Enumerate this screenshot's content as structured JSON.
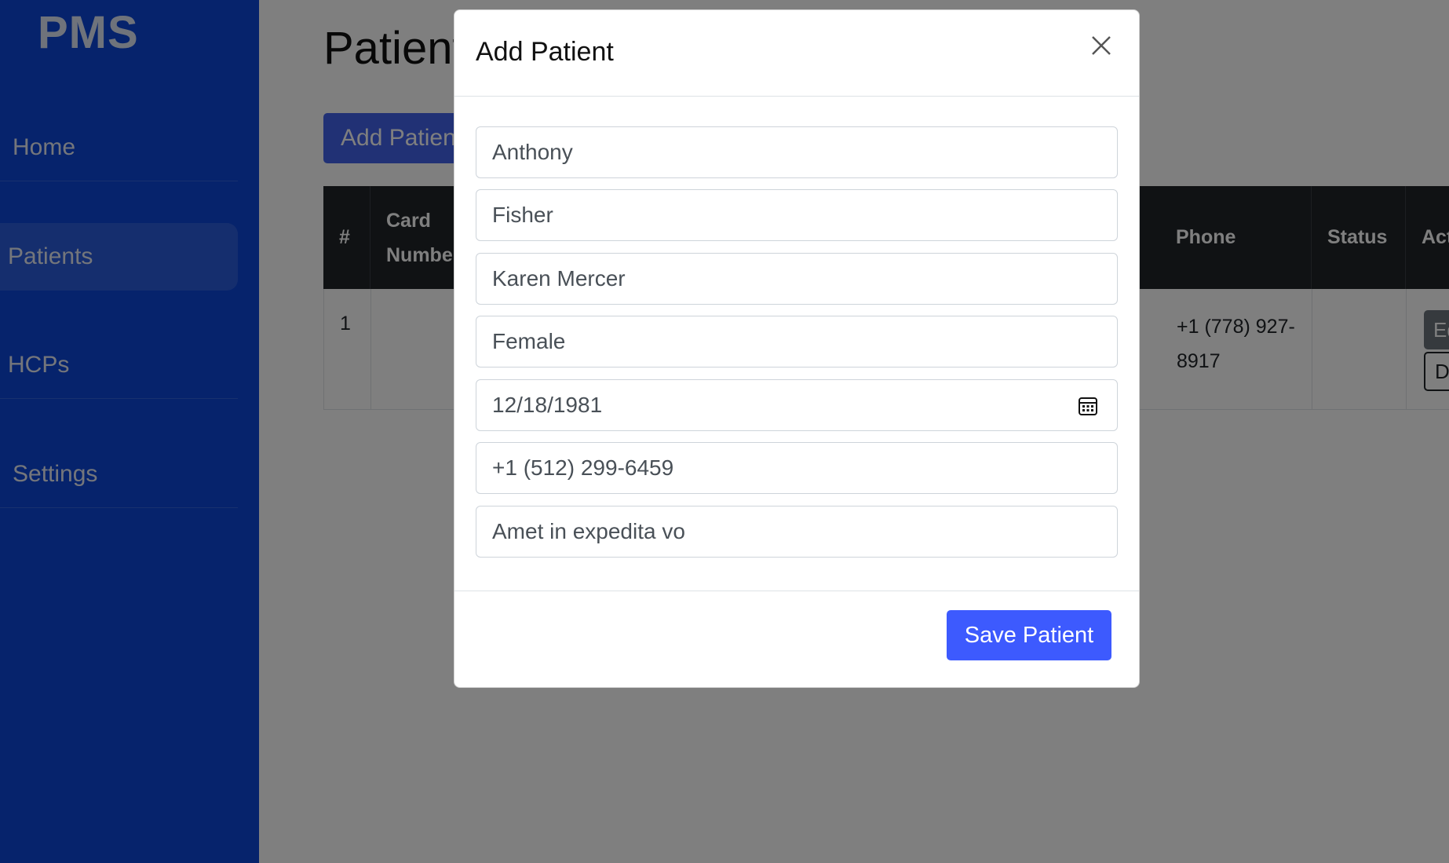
{
  "sidebar": {
    "logo": "PMS",
    "items": [
      {
        "label": "Home",
        "icon": "home-icon"
      },
      {
        "label": "Patients",
        "icon": "users-icon"
      },
      {
        "label": "HCPs",
        "icon": "doctor-icon"
      },
      {
        "label": "Settings",
        "icon": "gear-icon"
      }
    ]
  },
  "main": {
    "title": "Patients",
    "add_button": "Add Patient",
    "table": {
      "headers": [
        "#",
        "Card Number",
        "Phone",
        "Status",
        "Actions"
      ],
      "rows": [
        {
          "num": "1",
          "card": "",
          "phone": "+1 (778) 927-8917",
          "status": "",
          "edit": "Edit",
          "delete": "Delete"
        }
      ]
    }
  },
  "modal": {
    "title": "Add Patient",
    "fields": {
      "first_name": "Anthony",
      "last_name": "Fisher",
      "guardian": "Karen Mercer",
      "gender": "Female",
      "dob": "12/18/1981",
      "phone": "+1 (512) 299-6459",
      "address": "Amet in expedita vo"
    },
    "save_label": "Save Patient"
  },
  "colors": {
    "sidebar_bg": "#0d47d9",
    "primary": "#3d5afe",
    "table_head": "#212529"
  }
}
